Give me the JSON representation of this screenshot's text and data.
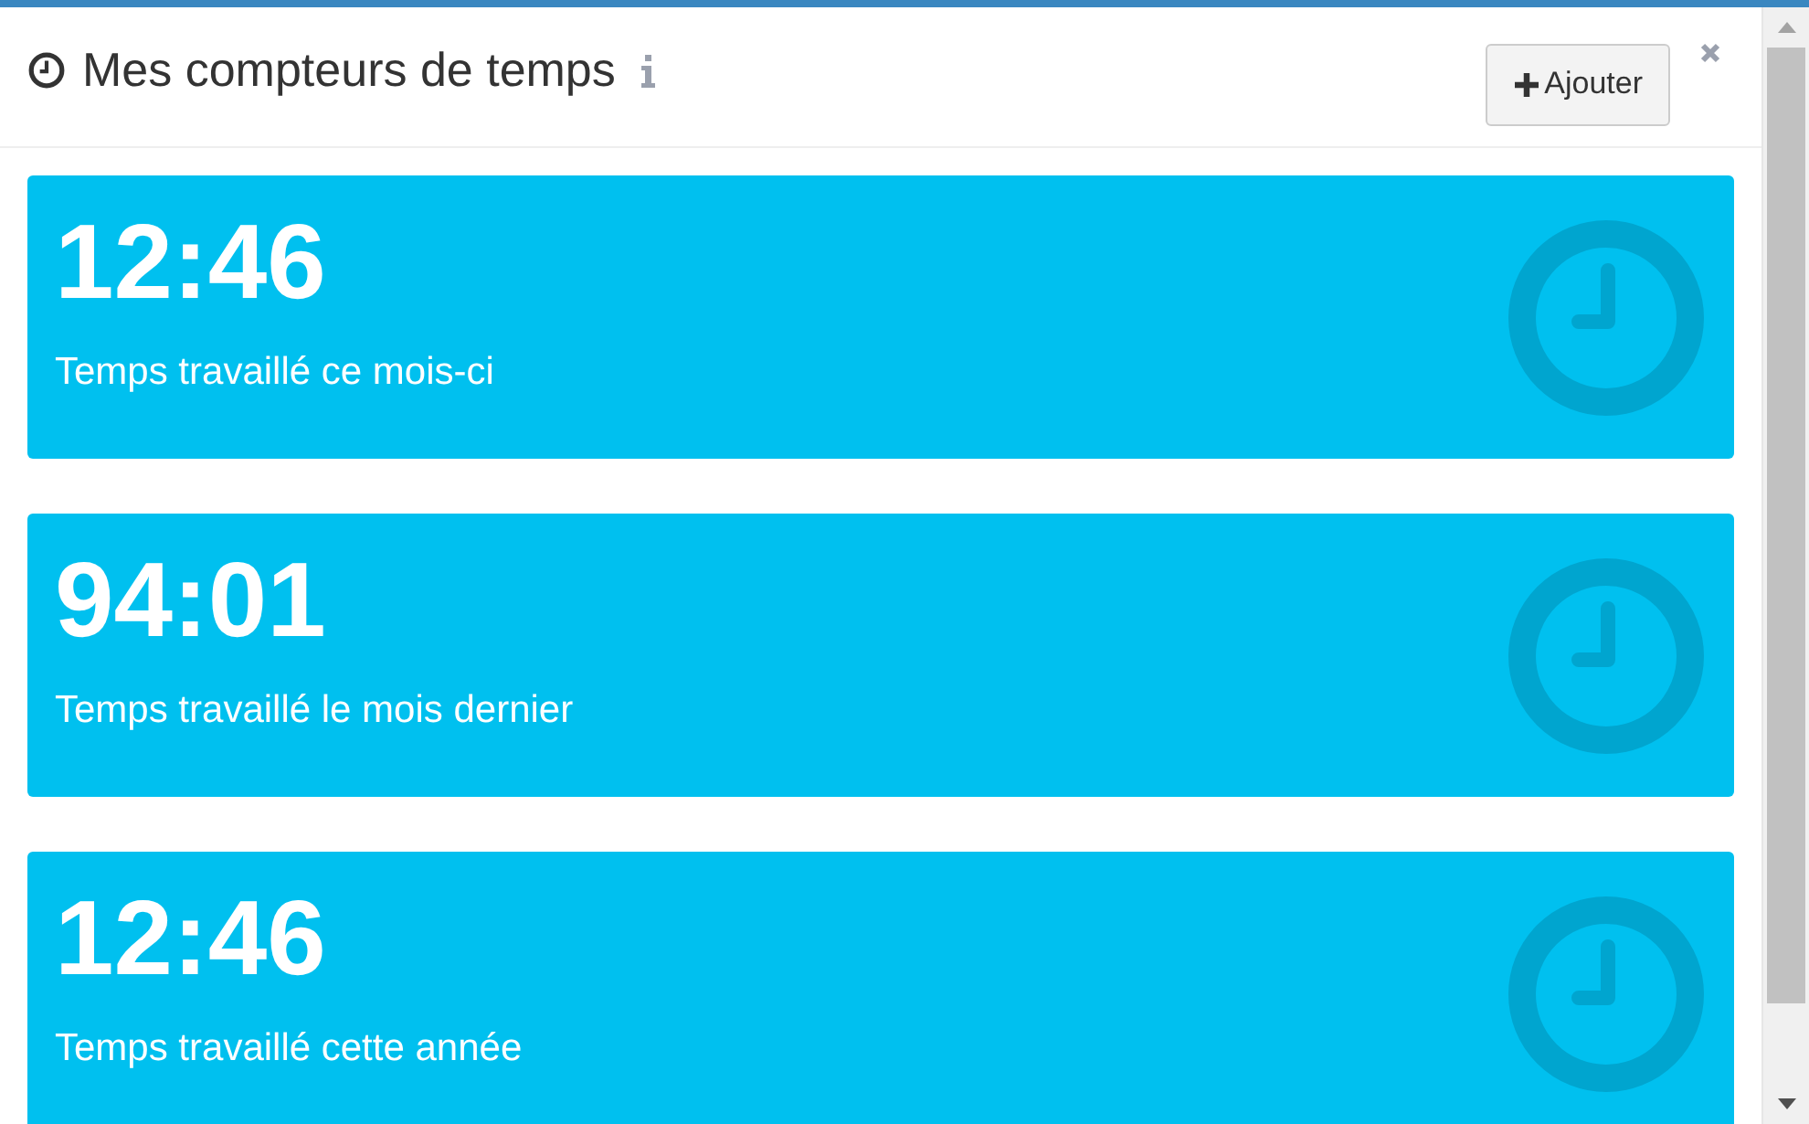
{
  "header": {
    "title": "Mes compteurs de temps",
    "add_button": "Ajouter"
  },
  "counters": [
    {
      "value": "12:46",
      "label": "Temps travaillé ce mois-ci"
    },
    {
      "value": "94:01",
      "label": "Temps travaillé le mois dernier"
    },
    {
      "value": "12:46",
      "label": "Temps travaillé cette année"
    }
  ]
}
